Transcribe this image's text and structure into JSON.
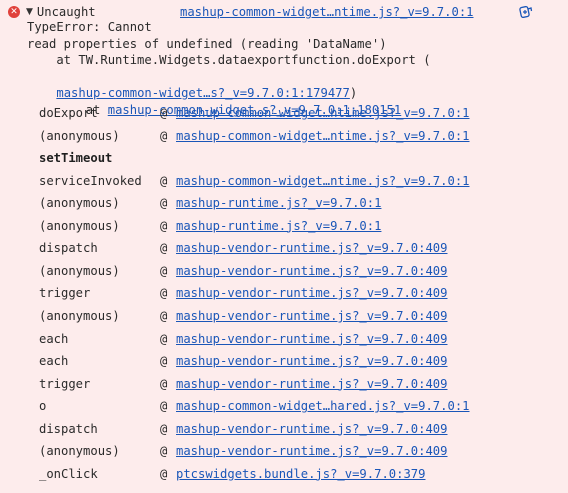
{
  "header": {
    "icon": "error-circle-icon",
    "label": "Uncaught",
    "source_link": "mashup-common-widget…ntime.js?_v=9.7.0:1",
    "copy_icon": "ai-explain-icon"
  },
  "message": {
    "line1": "TypeError: Cannot",
    "line2": "read properties of undefined (reading 'DataName')",
    "line3": "    at TW.Runtime.Widgets.dataexportfunction.doExport (",
    "line4_link": "mashup-common-widget…s?_v=9.7.0:1:179477",
    "line4_tail": ")",
    "line5_prefix": "    at ",
    "line5_link": "mashup-common-widget…s?_v=9.7.0:1:180151"
  },
  "stack": {
    "at_symbol": "@",
    "async_label": "setTimeout",
    "frames_before": [
      {
        "fn": "doExport",
        "loc": "mashup-common-widget…ntime.js?_v=9.7.0:1"
      },
      {
        "fn": "(anonymous)",
        "loc": "mashup-common-widget…ntime.js?_v=9.7.0:1"
      }
    ],
    "frames_after": [
      {
        "fn": "serviceInvoked",
        "loc": "mashup-common-widget…ntime.js?_v=9.7.0:1"
      },
      {
        "fn": "(anonymous)",
        "loc": "mashup-runtime.js?_v=9.7.0:1"
      },
      {
        "fn": "(anonymous)",
        "loc": "mashup-runtime.js?_v=9.7.0:1"
      },
      {
        "fn": "dispatch",
        "loc": "mashup-vendor-runtime.js?_v=9.7.0:409"
      },
      {
        "fn": "(anonymous)",
        "loc": "mashup-vendor-runtime.js?_v=9.7.0:409"
      },
      {
        "fn": "trigger",
        "loc": "mashup-vendor-runtime.js?_v=9.7.0:409"
      },
      {
        "fn": "(anonymous)",
        "loc": "mashup-vendor-runtime.js?_v=9.7.0:409"
      },
      {
        "fn": "each",
        "loc": "mashup-vendor-runtime.js?_v=9.7.0:409"
      },
      {
        "fn": "each",
        "loc": "mashup-vendor-runtime.js?_v=9.7.0:409"
      },
      {
        "fn": "trigger",
        "loc": "mashup-vendor-runtime.js?_v=9.7.0:409"
      },
      {
        "fn": "o",
        "loc": "mashup-common-widget…hared.js?_v=9.7.0:1"
      },
      {
        "fn": "dispatch",
        "loc": "mashup-vendor-runtime.js?_v=9.7.0:409"
      },
      {
        "fn": "(anonymous)",
        "loc": "mashup-vendor-runtime.js?_v=9.7.0:409"
      },
      {
        "fn": "_onClick",
        "loc": "ptcswidgets.bundle.js?_v=9.7.0:379"
      }
    ]
  },
  "colors": {
    "background": "#fdecec",
    "link": "#1a56b8",
    "error": "#e0413b"
  }
}
